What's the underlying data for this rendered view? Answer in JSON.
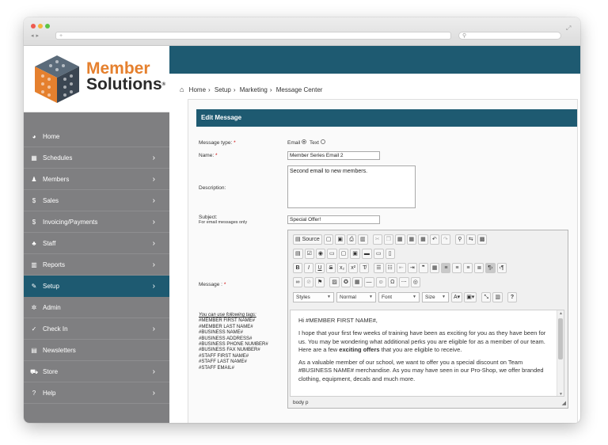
{
  "browser": {
    "url": "",
    "search_placeholder": ""
  },
  "logo": {
    "line1": "Member",
    "line2": "Solutions"
  },
  "menu": [
    {
      "label": "Home",
      "icon": "dashboard-icon",
      "glyph": "◕",
      "chevron": false
    },
    {
      "label": "Schedules",
      "icon": "calendar-icon",
      "glyph": "▦",
      "chevron": true
    },
    {
      "label": "Members",
      "icon": "user-icon",
      "glyph": "♟",
      "chevron": true
    },
    {
      "label": "Sales",
      "icon": "dollar-icon",
      "glyph": "$",
      "chevron": true
    },
    {
      "label": "Invoicing/Payments",
      "icon": "dollar-icon",
      "glyph": "$",
      "chevron": true
    },
    {
      "label": "Staff",
      "icon": "group-icon",
      "glyph": "♣",
      "chevron": true
    },
    {
      "label": "Reports",
      "icon": "bar-chart-icon",
      "glyph": "▥",
      "chevron": true
    },
    {
      "label": "Setup",
      "icon": "wrench-icon",
      "glyph": "✎",
      "chevron": true,
      "active": true
    },
    {
      "label": "Admin",
      "icon": "gear-icon",
      "glyph": "✲",
      "chevron": false
    },
    {
      "label": "Check In",
      "icon": "check-circle-icon",
      "glyph": "✓",
      "chevron": true
    },
    {
      "label": "Newsletters",
      "icon": "newspaper-icon",
      "glyph": "▤",
      "chevron": false
    },
    {
      "label": "Store",
      "icon": "cart-icon",
      "glyph": "⛟",
      "chevron": true
    },
    {
      "label": "Help",
      "icon": "question-circle-icon",
      "glyph": "?",
      "chevron": true
    }
  ],
  "breadcrumb": [
    "Home",
    "Setup",
    "Marketing",
    "Message Center"
  ],
  "panel": {
    "title": "Edit Message"
  },
  "form": {
    "message_type_label": "Message type:",
    "email_option": "Email",
    "text_option": "Text",
    "name_label": "Name:",
    "name_value": "Member Series Email 2",
    "description_label": "Description:",
    "description_value": "Second email to new members.",
    "subject_label": "Subject:",
    "subject_note": "For email messages only",
    "subject_value": "Special Offer!",
    "message_label": "Message :",
    "tags_hint": "You can use following tags:",
    "tags": [
      "#MEMBER FIRST NAME#",
      "#MEMBER LAST NAME#",
      "#BUSINESS NAME#",
      "#BUSINESS ADDRESS#",
      "#BUSINESS PHONE NUMBER#",
      "#BUSINESS FAX NUMBER#",
      "#STAFF FIRST NAME#",
      "#STAFF LAST NAME#",
      "#STAFF EMAIL#"
    ]
  },
  "editor": {
    "source_label": "Source",
    "combos": {
      "styles": "Styles",
      "format": "Normal",
      "font": "Font",
      "size": "Size"
    },
    "body": {
      "greeting": "Hi #MEMBER FIRST NAME#,",
      "p1_before": "I hope that your first few weeks of training have been as exciting for you as they have been for us.  You may be wondering what additional perks you are eligible for as a member of our team.  Here are a few ",
      "p1_bold": "exciting offers",
      "p1_after": " that you are eligible to receive.",
      "p2": "As a valuable member of our school, we want to offer you a special discount on Team #BUSINESS NAME# merchandise.  As you may have seen in our Pro-Shop, we offer branded clothing, equipment, decals and much more."
    },
    "status_path": "body  p"
  },
  "colors": {
    "accent": "#1e5a71",
    "sidebar": "#7f7f81",
    "brand_orange": "#e5802e"
  }
}
